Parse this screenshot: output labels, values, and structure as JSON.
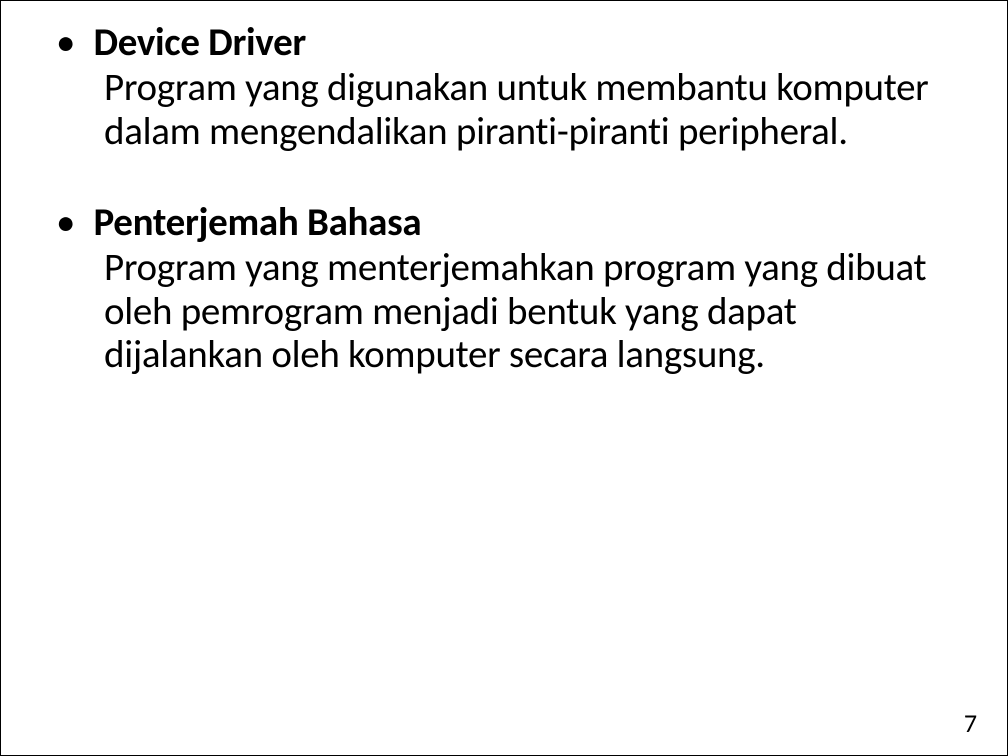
{
  "slide": {
    "items": [
      {
        "title": "Device Driver",
        "body": "Program yang digunakan untuk membantu komputer dalam mengendalikan piranti-piranti peripheral."
      },
      {
        "title": "Penterjemah Bahasa",
        "body": "Program yang menterjemahkan program yang dibuat oleh pemrogram menjadi bentuk yang dapat dijalankan oleh komputer secara langsung."
      }
    ],
    "page_number": "7"
  }
}
